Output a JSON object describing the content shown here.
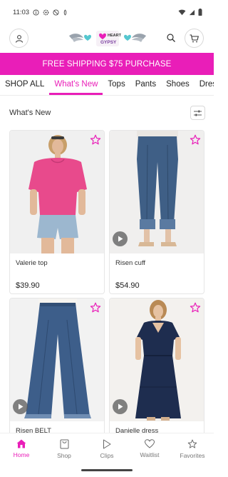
{
  "status_bar": {
    "time": "11:03",
    "icons": [
      "info-icon",
      "settings-icon",
      "blocked-icon",
      "dnd-icon",
      "wifi-icon",
      "signal-icon",
      "battery-icon"
    ]
  },
  "header": {
    "logo_text": "iHEART GYPSY",
    "icons": [
      "account-icon",
      "search-icon",
      "cart-icon"
    ]
  },
  "promo_banner": {
    "text": "FREE SHIPPING $75 PURCHASE"
  },
  "categories": [
    {
      "label": "SHOP ALL",
      "active": false
    },
    {
      "label": "What's New",
      "active": true
    },
    {
      "label": "Tops",
      "active": false
    },
    {
      "label": "Pants",
      "active": false
    },
    {
      "label": "Shoes",
      "active": false
    },
    {
      "label": "Dresses",
      "active": false
    }
  ],
  "section": {
    "title": "What's New",
    "filter_icon": "sliders-icon"
  },
  "products": [
    {
      "name": "Valerie top",
      "price": "$39.90",
      "has_video": false
    },
    {
      "name": "Risen cuff",
      "price": "$54.90",
      "has_video": true
    },
    {
      "name": "Risen BELT",
      "price": "",
      "has_video": true
    },
    {
      "name": "Danielle dress",
      "price": "",
      "has_video": true
    }
  ],
  "bottom_nav": [
    {
      "label": "Home",
      "icon": "home-icon",
      "active": true
    },
    {
      "label": "Shop",
      "icon": "shopping-bag-icon",
      "active": false
    },
    {
      "label": "Clips",
      "icon": "play-icon",
      "active": false
    },
    {
      "label": "Waitlist",
      "icon": "heart-icon",
      "active": false
    },
    {
      "label": "Favorites",
      "icon": "star-icon",
      "active": false
    }
  ],
  "colors": {
    "accent": "#e91eb8",
    "text": "#222222",
    "muted": "#777777",
    "border": "#e6e6e6"
  }
}
